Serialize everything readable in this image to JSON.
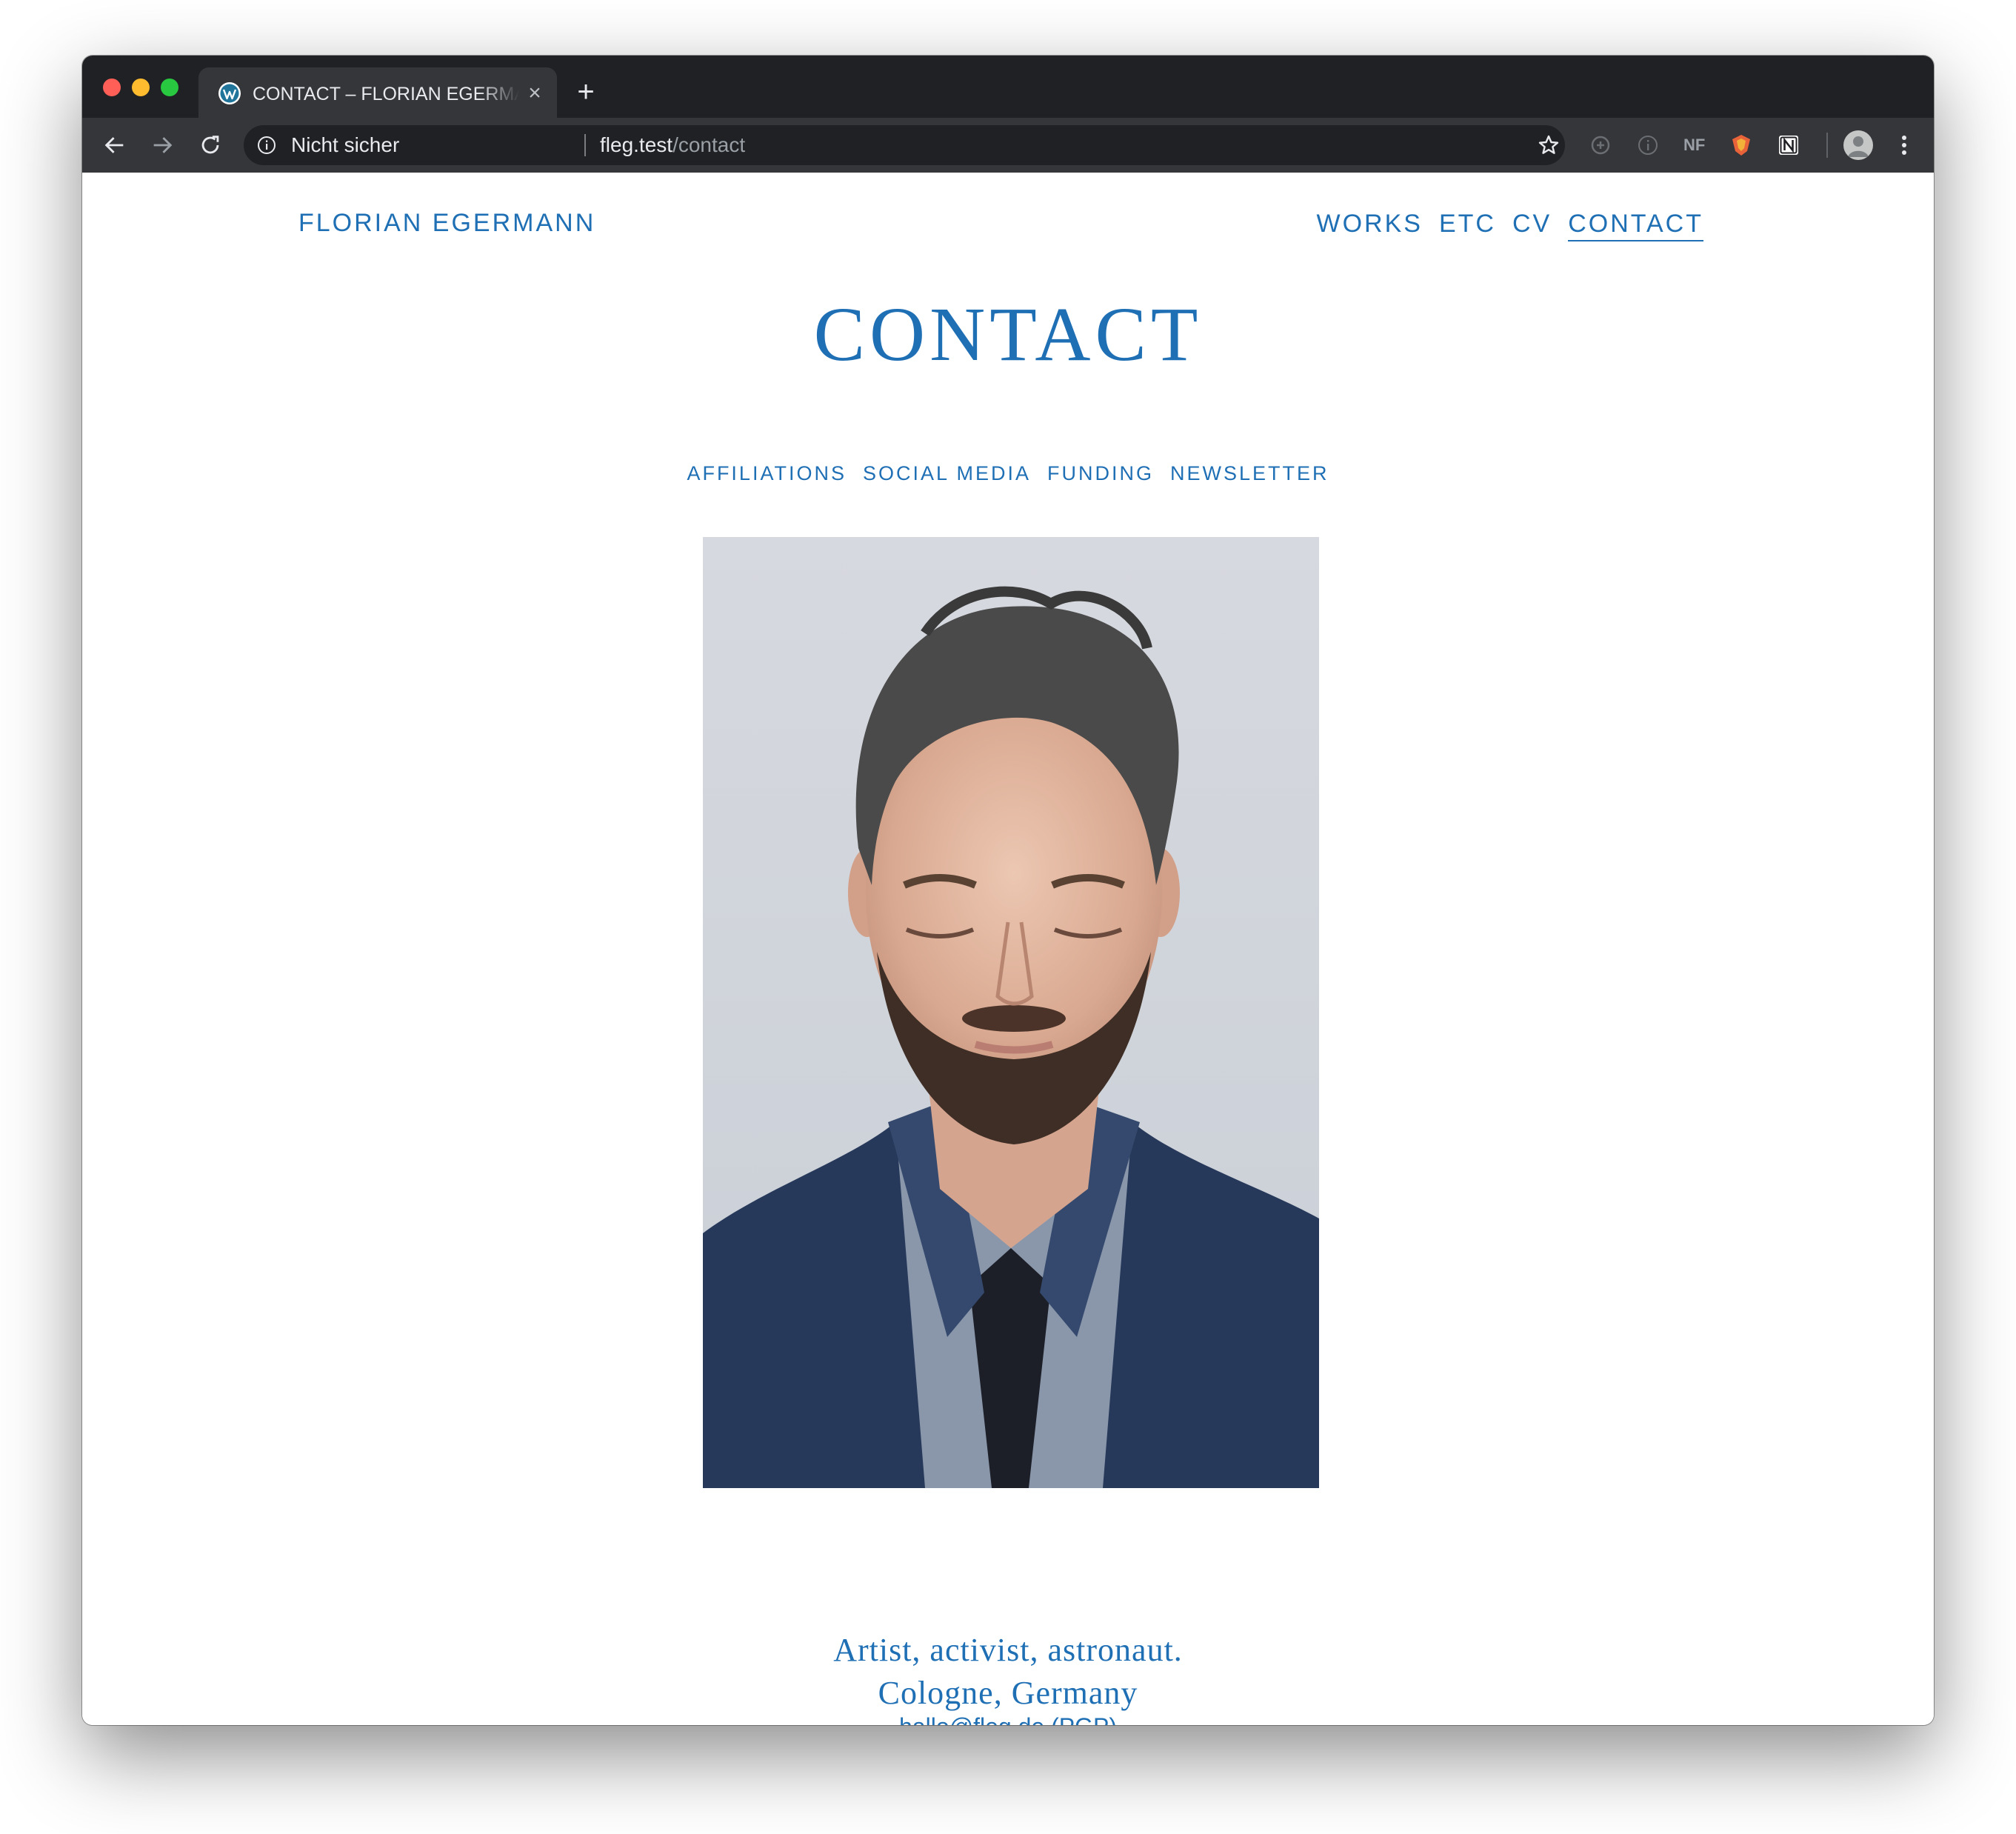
{
  "browser": {
    "tab_title": "CONTACT – FLORIAN EGERMANN",
    "tab_close": "×",
    "new_tab": "+",
    "security_label": "Nicht sicher",
    "url_host": "fleg.test",
    "url_path": "/contact",
    "extension_label": "NF"
  },
  "site": {
    "name": "FLORIAN EGERMANN",
    "nav": [
      "WORKS",
      "ETC",
      "CV",
      "CONTACT"
    ],
    "active_nav": "CONTACT"
  },
  "page": {
    "title": "CONTACT",
    "sub_nav": [
      "AFFILIATIONS",
      "SOCIAL MEDIA",
      "FUNDING",
      "NEWSLETTER"
    ],
    "bio_line1": "Artist, activist, astronaut.",
    "bio_line2": "Cologne, Germany",
    "email": "hallo@fleg.de",
    "pgp": "(PGP)"
  },
  "colors": {
    "accent": "#1f6fb5",
    "chrome_dark": "#202124",
    "chrome_toolbar": "#35363a"
  },
  "icons": [
    "wordpress-icon",
    "back-arrow-icon",
    "forward-arrow-icon",
    "reload-icon",
    "info-icon",
    "star-icon",
    "extension-icon",
    "profile-avatar-icon",
    "more-menu-icon"
  ]
}
